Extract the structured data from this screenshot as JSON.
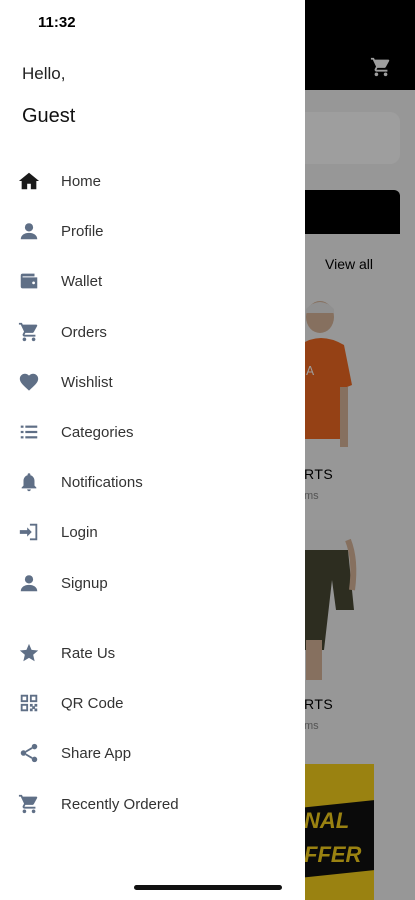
{
  "status_bar": {
    "time": "11:32"
  },
  "drawer": {
    "greeting": "Hello,",
    "user_name": "Guest",
    "menu": [
      {
        "label": "Home",
        "icon": "home-icon"
      },
      {
        "label": "Profile",
        "icon": "person-icon"
      },
      {
        "label": "Wallet",
        "icon": "wallet-icon"
      },
      {
        "label": "Orders",
        "icon": "cart-icon"
      },
      {
        "label": "Wishlist",
        "icon": "heart-icon"
      },
      {
        "label": "Categories",
        "icon": "list-icon"
      },
      {
        "label": "Notifications",
        "icon": "bell-icon"
      },
      {
        "label": "Login",
        "icon": "login-icon"
      },
      {
        "label": "Signup",
        "icon": "person-add-icon"
      }
    ],
    "secondary_menu": [
      {
        "label": "Rate Us",
        "icon": "star-icon"
      },
      {
        "label": "QR Code",
        "icon": "qr-code-icon"
      },
      {
        "label": "Share App",
        "icon": "share-icon"
      },
      {
        "label": "Recently Ordered",
        "icon": "cart-icon"
      }
    ]
  },
  "background": {
    "view_all": "View all",
    "product1_label": "RTS",
    "product1_sub": "ms",
    "product2_label": "RTS",
    "product2_sub": "ms",
    "offer_line1": "NAL",
    "offer_line2": "FFER"
  },
  "colors": {
    "icon_primary": "#1a1a1a",
    "icon_muted": "#5f6f86",
    "offer_yellow": "#f8d21c"
  }
}
